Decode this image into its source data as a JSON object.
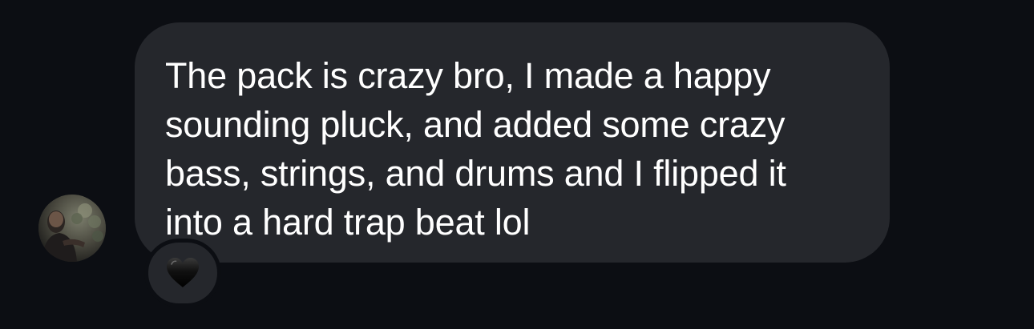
{
  "message": {
    "text": "The pack is crazy bro, I made a happy\nsounding pluck, and added some crazy\nbass, strings, and drums and I flipped it\ninto a hard trap beat lol",
    "reaction_icon": "black-heart-icon"
  },
  "colors": {
    "background": "#0c0e13",
    "bubble": "#25272c",
    "text": "#ffffff",
    "reaction_heart": "#050505"
  }
}
